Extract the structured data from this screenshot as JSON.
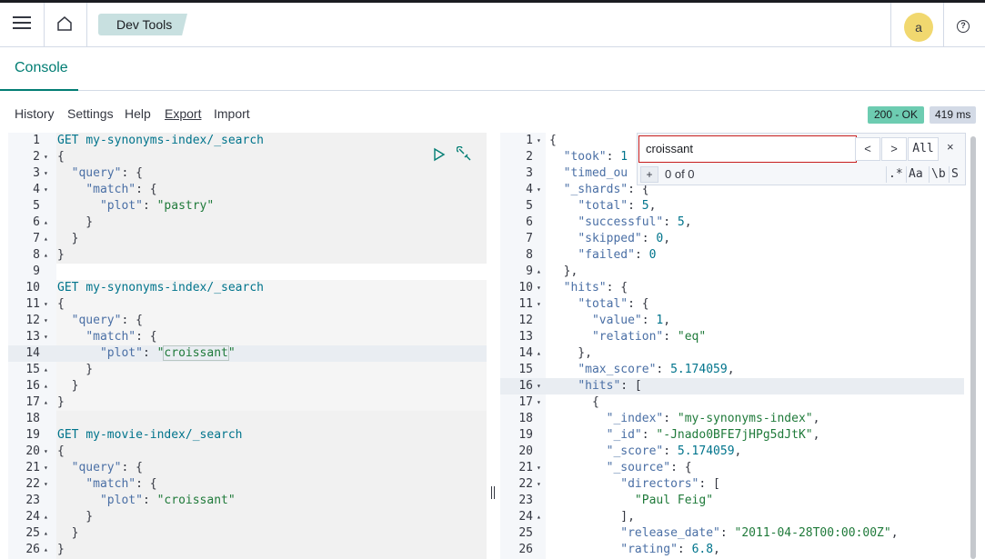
{
  "header": {
    "breadcrumb": "Dev Tools",
    "avatar_letter": "a",
    "help_icon": "?"
  },
  "tabs": {
    "console": "Console"
  },
  "toolbar": {
    "history": "History",
    "settings": "Settings",
    "help": "Help",
    "export": "Export",
    "import": "Import",
    "status": "200 - OK",
    "time": "419 ms"
  },
  "search": {
    "value": "croissant",
    "all_label": "All",
    "prev": "<",
    "next": ">",
    "close": "×",
    "add": "+",
    "count": "0 of 0",
    "opt_regex": ".*",
    "opt_case": "Aa",
    "opt_word": "\\b",
    "opt_selection": "S"
  },
  "colors": {
    "accent": "#017d73",
    "status_ok": "#6dccb1",
    "avatar": "#f1d86f",
    "search_border": "#c71c1c"
  },
  "left_editor": [
    {
      "n": "1",
      "fold": "",
      "code": [
        [
          "m",
          "GET "
        ],
        [
          "u",
          "my-synonyms-index/_search"
        ]
      ]
    },
    {
      "n": "2",
      "fold": "▾",
      "code": [
        [
          "p",
          "{"
        ]
      ]
    },
    {
      "n": "3",
      "fold": "▾",
      "code": [
        [
          "p",
          "  "
        ],
        [
          "k",
          "\"query\""
        ],
        [
          "p",
          ": {"
        ]
      ]
    },
    {
      "n": "4",
      "fold": "▾",
      "code": [
        [
          "p",
          "    "
        ],
        [
          "k",
          "\"match\""
        ],
        [
          "p",
          ": {"
        ]
      ]
    },
    {
      "n": "5",
      "fold": "",
      "code": [
        [
          "p",
          "      "
        ],
        [
          "k",
          "\"plot\""
        ],
        [
          "p",
          ": "
        ],
        [
          "s",
          "\"pastry\""
        ]
      ]
    },
    {
      "n": "6",
      "fold": "▴",
      "code": [
        [
          "p",
          "    }"
        ]
      ]
    },
    {
      "n": "7",
      "fold": "▴",
      "code": [
        [
          "p",
          "  }"
        ]
      ]
    },
    {
      "n": "8",
      "fold": "▴",
      "code": [
        [
          "p",
          "}"
        ]
      ]
    },
    {
      "n": "9",
      "fold": "",
      "code": []
    },
    {
      "n": "10",
      "fold": "",
      "code": [
        [
          "m",
          "GET "
        ],
        [
          "u",
          "my-synonyms-index/_search"
        ]
      ]
    },
    {
      "n": "11",
      "fold": "▾",
      "code": [
        [
          "p",
          "{"
        ]
      ]
    },
    {
      "n": "12",
      "fold": "▾",
      "code": [
        [
          "p",
          "  "
        ],
        [
          "k",
          "\"query\""
        ],
        [
          "p",
          ": {"
        ]
      ]
    },
    {
      "n": "13",
      "fold": "▾",
      "code": [
        [
          "p",
          "    "
        ],
        [
          "k",
          "\"match\""
        ],
        [
          "p",
          ": {"
        ]
      ]
    },
    {
      "n": "14",
      "fold": "",
      "code": [
        [
          "p",
          "      "
        ],
        [
          "k",
          "\"plot\""
        ],
        [
          "p",
          ": "
        ],
        [
          "s",
          "\""
        ],
        [
          "sh",
          "croissant"
        ],
        [
          "s",
          "\""
        ]
      ]
    },
    {
      "n": "15",
      "fold": "▴",
      "code": [
        [
          "p",
          "    }"
        ]
      ]
    },
    {
      "n": "16",
      "fold": "▴",
      "code": [
        [
          "p",
          "  }"
        ]
      ]
    },
    {
      "n": "17",
      "fold": "▴",
      "code": [
        [
          "p",
          "}"
        ]
      ]
    },
    {
      "n": "18",
      "fold": "",
      "code": []
    },
    {
      "n": "19",
      "fold": "",
      "code": [
        [
          "m",
          "GET "
        ],
        [
          "u",
          "my-movie-index/_search"
        ]
      ]
    },
    {
      "n": "20",
      "fold": "▾",
      "code": [
        [
          "p",
          "{"
        ]
      ]
    },
    {
      "n": "21",
      "fold": "▾",
      "code": [
        [
          "p",
          "  "
        ],
        [
          "k",
          "\"query\""
        ],
        [
          "p",
          ": {"
        ]
      ]
    },
    {
      "n": "22",
      "fold": "▾",
      "code": [
        [
          "p",
          "    "
        ],
        [
          "k",
          "\"match\""
        ],
        [
          "p",
          ": {"
        ]
      ]
    },
    {
      "n": "23",
      "fold": "",
      "code": [
        [
          "p",
          "      "
        ],
        [
          "k",
          "\"plot\""
        ],
        [
          "p",
          ": "
        ],
        [
          "s",
          "\"croissant\""
        ]
      ]
    },
    {
      "n": "24",
      "fold": "▴",
      "code": [
        [
          "p",
          "    }"
        ]
      ]
    },
    {
      "n": "25",
      "fold": "▴",
      "code": [
        [
          "p",
          "  }"
        ]
      ]
    },
    {
      "n": "26",
      "fold": "▴",
      "code": [
        [
          "p",
          "}"
        ]
      ]
    }
  ],
  "right_editor": [
    {
      "n": "1",
      "fold": "▾",
      "code": [
        [
          "p",
          "{"
        ]
      ]
    },
    {
      "n": "2",
      "fold": "",
      "code": [
        [
          "p",
          "  "
        ],
        [
          "k",
          "\"took\""
        ],
        [
          "p",
          ": "
        ],
        [
          "n",
          "1"
        ]
      ]
    },
    {
      "n": "3",
      "fold": "",
      "code": [
        [
          "p",
          "  "
        ],
        [
          "k",
          "\"timed_ou"
        ]
      ]
    },
    {
      "n": "4",
      "fold": "▾",
      "code": [
        [
          "p",
          "  "
        ],
        [
          "k",
          "\"_shards\""
        ],
        [
          "p",
          ": {"
        ]
      ]
    },
    {
      "n": "5",
      "fold": "",
      "code": [
        [
          "p",
          "    "
        ],
        [
          "k",
          "\"total\""
        ],
        [
          "p",
          ": "
        ],
        [
          "n",
          "5"
        ],
        [
          "p",
          ","
        ]
      ]
    },
    {
      "n": "6",
      "fold": "",
      "code": [
        [
          "p",
          "    "
        ],
        [
          "k",
          "\"successful\""
        ],
        [
          "p",
          ": "
        ],
        [
          "n",
          "5"
        ],
        [
          "p",
          ","
        ]
      ]
    },
    {
      "n": "7",
      "fold": "",
      "code": [
        [
          "p",
          "    "
        ],
        [
          "k",
          "\"skipped\""
        ],
        [
          "p",
          ": "
        ],
        [
          "n",
          "0"
        ],
        [
          "p",
          ","
        ]
      ]
    },
    {
      "n": "8",
      "fold": "",
      "code": [
        [
          "p",
          "    "
        ],
        [
          "k",
          "\"failed\""
        ],
        [
          "p",
          ": "
        ],
        [
          "n",
          "0"
        ]
      ]
    },
    {
      "n": "9",
      "fold": "▴",
      "code": [
        [
          "p",
          "  },"
        ]
      ]
    },
    {
      "n": "10",
      "fold": "▾",
      "code": [
        [
          "p",
          "  "
        ],
        [
          "k",
          "\"hits\""
        ],
        [
          "p",
          ": {"
        ]
      ]
    },
    {
      "n": "11",
      "fold": "▾",
      "code": [
        [
          "p",
          "    "
        ],
        [
          "k",
          "\"total\""
        ],
        [
          "p",
          ": {"
        ]
      ]
    },
    {
      "n": "12",
      "fold": "",
      "code": [
        [
          "p",
          "      "
        ],
        [
          "k",
          "\"value\""
        ],
        [
          "p",
          ": "
        ],
        [
          "n",
          "1"
        ],
        [
          "p",
          ","
        ]
      ]
    },
    {
      "n": "13",
      "fold": "",
      "code": [
        [
          "p",
          "      "
        ],
        [
          "k",
          "\"relation\""
        ],
        [
          "p",
          ": "
        ],
        [
          "s",
          "\"eq\""
        ]
      ]
    },
    {
      "n": "14",
      "fold": "▴",
      "code": [
        [
          "p",
          "    },"
        ]
      ]
    },
    {
      "n": "15",
      "fold": "",
      "code": [
        [
          "p",
          "    "
        ],
        [
          "k",
          "\"max_score\""
        ],
        [
          "p",
          ": "
        ],
        [
          "n",
          "5.174059"
        ],
        [
          "p",
          ","
        ]
      ]
    },
    {
      "n": "16",
      "fold": "▾",
      "code": [
        [
          "p",
          "    "
        ],
        [
          "k",
          "\"hits\""
        ],
        [
          "p",
          ": ["
        ]
      ]
    },
    {
      "n": "17",
      "fold": "▾",
      "code": [
        [
          "p",
          "      {"
        ]
      ]
    },
    {
      "n": "18",
      "fold": "",
      "code": [
        [
          "p",
          "        "
        ],
        [
          "k",
          "\"_index\""
        ],
        [
          "p",
          ": "
        ],
        [
          "s",
          "\"my-synonyms-index\""
        ],
        [
          "p",
          ","
        ]
      ]
    },
    {
      "n": "19",
      "fold": "",
      "code": [
        [
          "p",
          "        "
        ],
        [
          "k",
          "\"_id\""
        ],
        [
          "p",
          ": "
        ],
        [
          "s",
          "\"-Jnado0BFE7jHPg5dJtK\""
        ],
        [
          "p",
          ","
        ]
      ]
    },
    {
      "n": "20",
      "fold": "",
      "code": [
        [
          "p",
          "        "
        ],
        [
          "k",
          "\"_score\""
        ],
        [
          "p",
          ": "
        ],
        [
          "n",
          "5.174059"
        ],
        [
          "p",
          ","
        ]
      ]
    },
    {
      "n": "21",
      "fold": "▾",
      "code": [
        [
          "p",
          "        "
        ],
        [
          "k",
          "\"_source\""
        ],
        [
          "p",
          ": {"
        ]
      ]
    },
    {
      "n": "22",
      "fold": "▾",
      "code": [
        [
          "p",
          "          "
        ],
        [
          "k",
          "\"directors\""
        ],
        [
          "p",
          ": ["
        ]
      ]
    },
    {
      "n": "23",
      "fold": "",
      "code": [
        [
          "p",
          "            "
        ],
        [
          "s",
          "\"Paul Feig\""
        ]
      ]
    },
    {
      "n": "24",
      "fold": "▴",
      "code": [
        [
          "p",
          "          ],"
        ]
      ]
    },
    {
      "n": "25",
      "fold": "",
      "code": [
        [
          "p",
          "          "
        ],
        [
          "k",
          "\"release_date\""
        ],
        [
          "p",
          ": "
        ],
        [
          "s",
          "\"2011-04-28T00:00:00Z\""
        ],
        [
          "p",
          ","
        ]
      ]
    },
    {
      "n": "26",
      "fold": "",
      "code": [
        [
          "p",
          "          "
        ],
        [
          "k",
          "\"rating\""
        ],
        [
          "p",
          ": "
        ],
        [
          "n",
          "6.8"
        ],
        [
          "p",
          ","
        ]
      ]
    }
  ]
}
